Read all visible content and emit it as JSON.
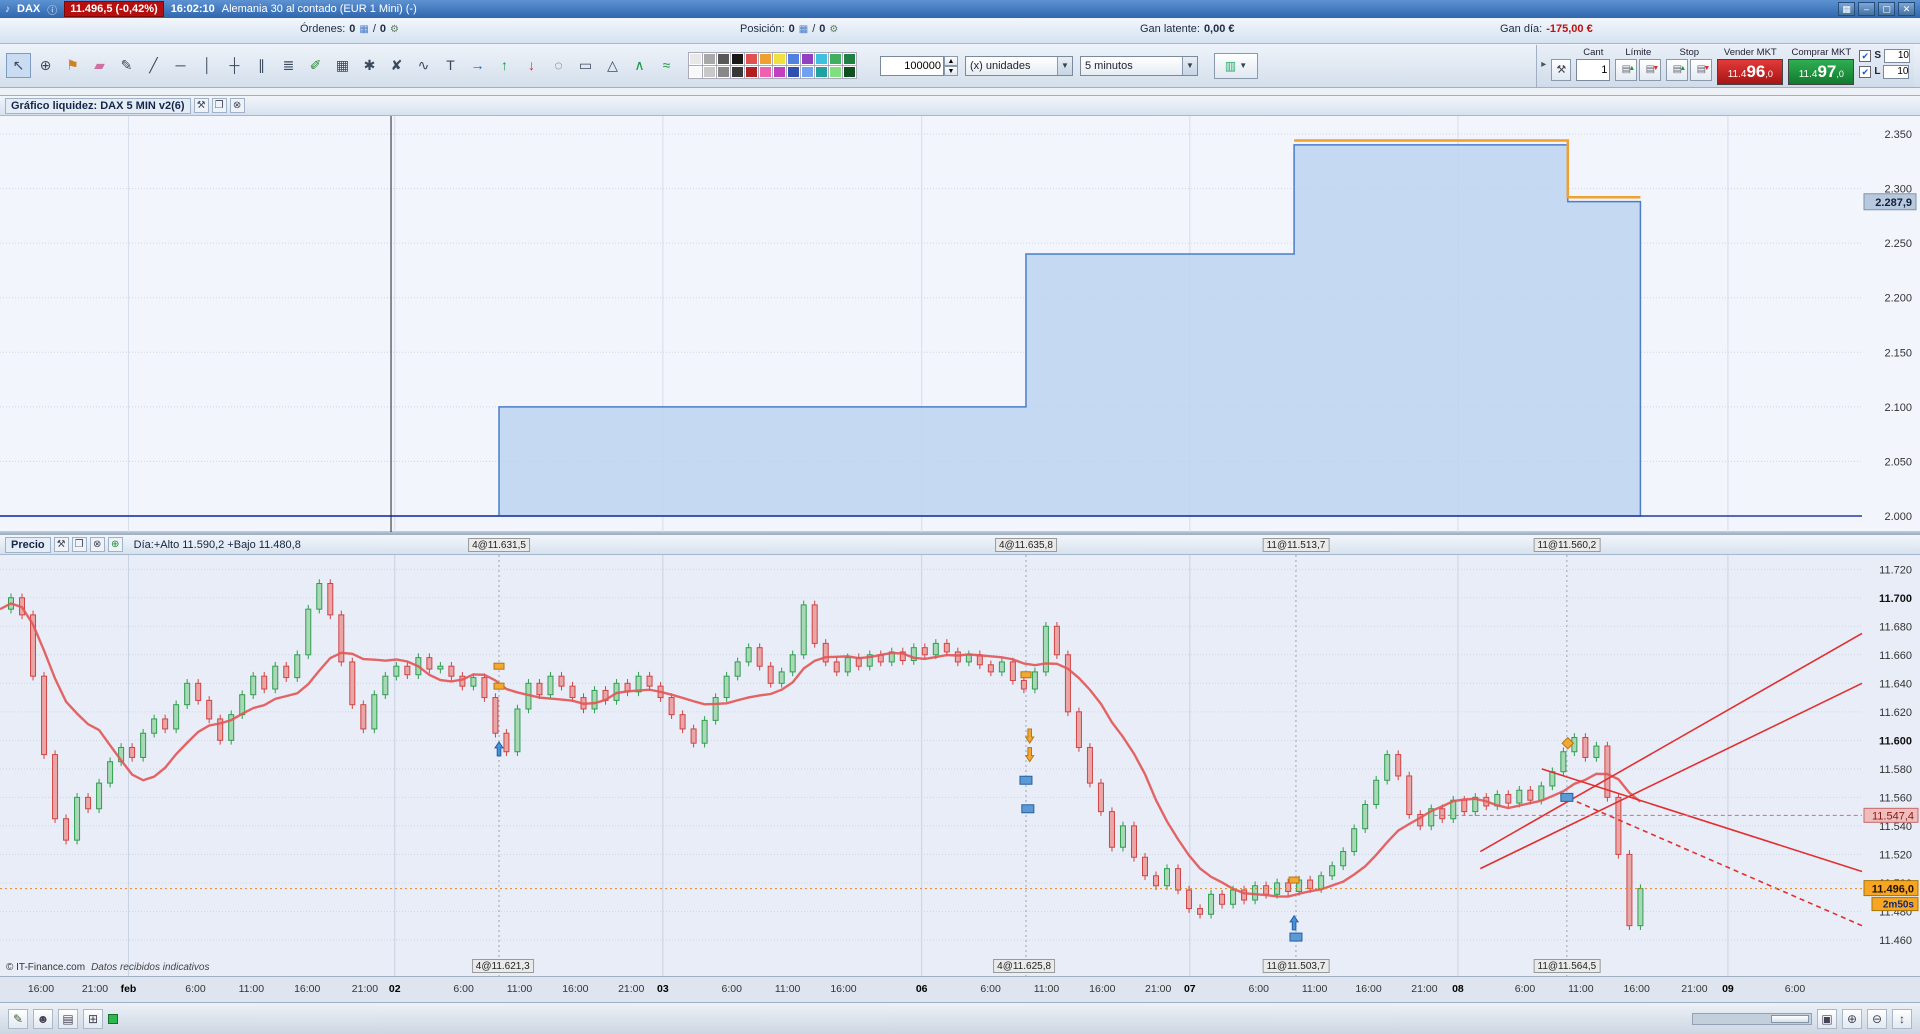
{
  "titlebar": {
    "instrument": "DAX",
    "price_badge": "11.496,5 (-0,42%)",
    "time": "16:02:10",
    "description": "Alemania 30 al contado (EUR 1 Mini) (-)",
    "window": {
      "minimize": "–",
      "maximize": "▢",
      "close": "✕"
    }
  },
  "infobar": {
    "ordenes_label": "Órdenes:",
    "ordenes_value": "0",
    "sep": "/",
    "ordenes_value2": "0",
    "posicion_label": "Posición:",
    "posicion_value": "0",
    "posicion_value2": "0",
    "gan_latente_label": "Gan latente:",
    "gan_latente_value": "0,00 €",
    "gan_dia_label": "Gan día:",
    "gan_dia_value": "-175,00 €"
  },
  "toolbar": {
    "tools": [
      {
        "name": "cursor-icon",
        "glyph": "↖",
        "active": true
      },
      {
        "name": "zoom-icon",
        "glyph": "⊕"
      },
      {
        "name": "alarm-icon",
        "glyph": "⚑",
        "color": "#d08020"
      },
      {
        "name": "eraser-icon",
        "glyph": "▰",
        "color": "#d070a0"
      },
      {
        "name": "pencil-icon",
        "glyph": "✎"
      },
      {
        "name": "trendline-icon",
        "glyph": "╱"
      },
      {
        "name": "horizontal-line-icon",
        "glyph": "─"
      },
      {
        "name": "vertical-line-icon",
        "glyph": "│"
      },
      {
        "name": "crosshair-icon",
        "glyph": "┼"
      },
      {
        "name": "parallel-lines-icon",
        "glyph": "∥"
      },
      {
        "name": "fibonacci-icon",
        "glyph": "≣"
      },
      {
        "name": "annotate-chart-icon",
        "glyph": "✐",
        "color": "#2a8a3a"
      },
      {
        "name": "trash-icon",
        "glyph": "▦"
      },
      {
        "name": "erase-drawings-icon",
        "glyph": "✱"
      },
      {
        "name": "delete-all-icon",
        "glyph": "✘"
      },
      {
        "name": "magnet-icon",
        "glyph": "∿"
      },
      {
        "name": "text-tool-icon",
        "glyph": "T"
      },
      {
        "name": "arrow-right-icon",
        "glyph": "→",
        "color": "#2a62c0"
      },
      {
        "name": "arrow-up-icon",
        "glyph": "↑",
        "color": "#1a9a40"
      },
      {
        "name": "arrow-down-icon",
        "glyph": "↓",
        "color": "#d03030"
      },
      {
        "name": "lasso-icon",
        "glyph": "◌"
      },
      {
        "name": "rectangle-icon",
        "glyph": "▭"
      },
      {
        "name": "triangle-icon",
        "glyph": "△"
      },
      {
        "name": "zigzag-icon",
        "glyph": "∧",
        "color": "#1a9a40"
      },
      {
        "name": "wave-icon",
        "glyph": "≈",
        "color": "#1a9a40"
      }
    ],
    "palette": [
      "#e8e8e8",
      "#f8f8f8",
      "#a8a8a8",
      "#c8c8c8",
      "#585858",
      "#888888",
      "#181818",
      "#383838",
      "#e05050",
      "#b02020",
      "#f0a030",
      "#f060b0",
      "#f0e040",
      "#c040c0",
      "#5080e0",
      "#3050b0",
      "#9040c0",
      "#70a0f0",
      "#40c0e0",
      "#20a0a0",
      "#40b060",
      "#80e080",
      "#208040",
      "#105020"
    ],
    "quantity_value": "100000",
    "units_select": "(x) unidades",
    "timeframe_select": "5 minutos",
    "trade": {
      "cant_label": "Cant",
      "cant_value": "1",
      "limite_label": "Límite",
      "stop_label": "Stop",
      "vender_label": "Vender MKT",
      "comprar_label": "Comprar MKT",
      "vender_price": {
        "pre": "11.4",
        "big": "96",
        "sup": ",0"
      },
      "comprar_price": {
        "pre": "11.4",
        "big": "97",
        "sup": ",0"
      },
      "s_label": "S",
      "s_value": "10",
      "l_label": "L",
      "l_value": "10",
      "check_glyph": "✔"
    }
  },
  "liquidity_panel": {
    "title": "Gráfico liquidez: DAX 5 MIN v2(6)",
    "badge": "2.287,9"
  },
  "price_panel": {
    "title": "Precio",
    "day_info": "Día:+Alto 11.590,2 +Bajo 11.480,8",
    "top_annotations": [
      {
        "x": 0.268,
        "text": "4@11.631,5"
      },
      {
        "x": 0.551,
        "text": "4@11.635,8"
      },
      {
        "x": 0.696,
        "text": "11@11.513,7"
      },
      {
        "x": 0.8415,
        "text": "11@11.560,2"
      }
    ],
    "bottom_annotations": [
      {
        "x": 0.27,
        "text": "4@11.621,3"
      },
      {
        "x": 0.55,
        "text": "4@11.625,8"
      },
      {
        "x": 0.696,
        "text": "11@11.503,7"
      },
      {
        "x": 0.8415,
        "text": "11@11.564,5"
      }
    ],
    "position_badge": "11.547,4",
    "last_price_badge": "11.496,0",
    "countdown_badge": "2m50s"
  },
  "timeline": {
    "labels": [
      {
        "x": 0.022,
        "text": "16:00",
        "bold": false
      },
      {
        "x": 0.051,
        "text": "21:00",
        "bold": false
      },
      {
        "x": 0.069,
        "text": "feb",
        "bold": true
      },
      {
        "x": 0.105,
        "text": "6:00",
        "bold": false
      },
      {
        "x": 0.135,
        "text": "11:00",
        "bold": false
      },
      {
        "x": 0.165,
        "text": "16:00",
        "bold": false
      },
      {
        "x": 0.196,
        "text": "21:00",
        "bold": false
      },
      {
        "x": 0.212,
        "text": "02",
        "bold": true
      },
      {
        "x": 0.249,
        "text": "6:00",
        "bold": false
      },
      {
        "x": 0.279,
        "text": "11:00",
        "bold": false
      },
      {
        "x": 0.309,
        "text": "16:00",
        "bold": false
      },
      {
        "x": 0.339,
        "text": "21:00",
        "bold": false
      },
      {
        "x": 0.356,
        "text": "03",
        "bold": true
      },
      {
        "x": 0.393,
        "text": "6:00",
        "bold": false
      },
      {
        "x": 0.423,
        "text": "11:00",
        "bold": false
      },
      {
        "x": 0.453,
        "text": "16:00",
        "bold": false
      },
      {
        "x": 0.495,
        "text": "06",
        "bold": true
      },
      {
        "x": 0.532,
        "text": "6:00",
        "bold": false
      },
      {
        "x": 0.562,
        "text": "11:00",
        "bold": false
      },
      {
        "x": 0.592,
        "text": "16:00",
        "bold": false
      },
      {
        "x": 0.622,
        "text": "21:00",
        "bold": false
      },
      {
        "x": 0.639,
        "text": "07",
        "bold": true
      },
      {
        "x": 0.676,
        "text": "6:00",
        "bold": false
      },
      {
        "x": 0.706,
        "text": "11:00",
        "bold": false
      },
      {
        "x": 0.735,
        "text": "16:00",
        "bold": false
      },
      {
        "x": 0.765,
        "text": "21:00",
        "bold": false
      },
      {
        "x": 0.783,
        "text": "08",
        "bold": true
      },
      {
        "x": 0.819,
        "text": "6:00",
        "bold": false
      },
      {
        "x": 0.849,
        "text": "11:00",
        "bold": false
      },
      {
        "x": 0.879,
        "text": "16:00",
        "bold": false
      },
      {
        "x": 0.91,
        "text": "21:00",
        "bold": false
      },
      {
        "x": 0.928,
        "text": "09",
        "bold": true
      },
      {
        "x": 0.964,
        "text": "6:00",
        "bold": false
      }
    ]
  },
  "statusbar": {
    "copyright": "© IT-Finance.com",
    "note": "Datos recibidos indicativos"
  },
  "chart_data": [
    {
      "type": "area",
      "title": "Gráfico liquidez: DAX 5 MIN v2(6)",
      "ylim": [
        2000,
        2350
      ],
      "y_ticks": [
        {
          "v": 2350,
          "label": "2.350"
        },
        {
          "v": 2300,
          "label": "2.300"
        },
        {
          "v": 2250,
          "label": "2.250"
        },
        {
          "v": 2200,
          "label": "2.200"
        },
        {
          "v": 2150,
          "label": "2.150"
        },
        {
          "v": 2100,
          "label": "2.100"
        },
        {
          "v": 2050,
          "label": "2.050"
        },
        {
          "v": 2000,
          "label": "2.000"
        }
      ],
      "current_value": 2287.9,
      "baseline": 2000,
      "day_marker_x": 0.21,
      "steps": [
        {
          "x0": 0.0,
          "x1": 0.268,
          "v": 2000
        },
        {
          "x0": 0.268,
          "x1": 0.551,
          "v": 2100
        },
        {
          "x0": 0.551,
          "x1": 0.695,
          "v": 2240
        },
        {
          "x0": 0.695,
          "x1": 0.842,
          "v": 2340
        },
        {
          "x0": 0.842,
          "x1": 0.881,
          "v": 2288
        }
      ],
      "overlay_line": {
        "color": "#f0a030",
        "segments": [
          {
            "x0": 0.695,
            "x1": 0.842,
            "v": 2344
          },
          {
            "x0": 0.842,
            "x1": 0.881,
            "v": 2292
          }
        ]
      }
    },
    {
      "type": "candlestick",
      "title": "Precio",
      "timeframe": "5 minutos",
      "ylim": [
        11434,
        11730
      ],
      "y_ticks": [
        {
          "v": 11720,
          "label": "11.720",
          "bold": false
        },
        {
          "v": 11700,
          "label": "11.700",
          "bold": true
        },
        {
          "v": 11680,
          "label": "11.680",
          "bold": false
        },
        {
          "v": 11660,
          "label": "11.660",
          "bold": false
        },
        {
          "v": 11640,
          "label": "11.640",
          "bold": false
        },
        {
          "v": 11620,
          "label": "11.620",
          "bold": false
        },
        {
          "v": 11600,
          "label": "11.600",
          "bold": true
        },
        {
          "v": 11580,
          "label": "11.580",
          "bold": false
        },
        {
          "v": 11560,
          "label": "11.560",
          "bold": false
        },
        {
          "v": 11540,
          "label": "11.540",
          "bold": false
        },
        {
          "v": 11520,
          "label": "11.520",
          "bold": false
        },
        {
          "v": 11500,
          "label": "11.500",
          "bold": true
        },
        {
          "v": 11480,
          "label": "11.480",
          "bold": false
        },
        {
          "v": 11460,
          "label": "11.460",
          "bold": false
        }
      ],
      "x_end_frac": 0.881,
      "ma_window": 10,
      "last_price": 11496.0,
      "position_price": 11547.4,
      "day_high": 11590.2,
      "day_low": 11480.8,
      "day_gridlines": [
        0.069,
        0.212,
        0.356,
        0.495,
        0.639,
        0.783,
        0.928
      ],
      "closes": [
        11692,
        11700,
        11688,
        11645,
        11590,
        11545,
        11530,
        11560,
        11552,
        11570,
        11585,
        11595,
        11588,
        11605,
        11615,
        11608,
        11625,
        11640,
        11628,
        11615,
        11600,
        11618,
        11632,
        11645,
        11636,
        11652,
        11644,
        11660,
        11692,
        11710,
        11688,
        11655,
        11625,
        11608,
        11632,
        11645,
        11652,
        11646,
        11658,
        11650,
        11652,
        11645,
        11638,
        11644,
        11630,
        11605,
        11592,
        11622,
        11640,
        11632,
        11645,
        11638,
        11630,
        11622,
        11635,
        11628,
        11640,
        11634,
        11645,
        11638,
        11630,
        11618,
        11608,
        11598,
        11614,
        11630,
        11645,
        11655,
        11665,
        11652,
        11640,
        11648,
        11660,
        11695,
        11668,
        11655,
        11648,
        11658,
        11652,
        11660,
        11655,
        11662,
        11656,
        11665,
        11660,
        11668,
        11662,
        11655,
        11660,
        11653,
        11648,
        11655,
        11642,
        11636,
        11648,
        11680,
        11660,
        11620,
        11595,
        11570,
        11550,
        11525,
        11540,
        11518,
        11505,
        11498,
        11510,
        11495,
        11482,
        11478,
        11492,
        11485,
        11495,
        11488,
        11498,
        11492,
        11500,
        11494,
        11502,
        11496,
        11505,
        11512,
        11522,
        11538,
        11555,
        11572,
        11590,
        11575,
        11548,
        11540,
        11552,
        11545,
        11558,
        11550,
        11560,
        11554,
        11562,
        11556,
        11565,
        11558,
        11568,
        11578,
        11592,
        11602,
        11588,
        11596,
        11560,
        11520,
        11470,
        11496
      ],
      "trend_lines": [
        {
          "x0": 0.795,
          "y0": 11522,
          "x1": 1.0,
          "y1": 11675,
          "dash": false
        },
        {
          "x0": 0.795,
          "y0": 11510,
          "x1": 1.0,
          "y1": 11640,
          "dash": false
        },
        {
          "x0": 0.828,
          "y0": 11580,
          "x1": 1.0,
          "y1": 11508,
          "dash": false
        },
        {
          "x0": 0.838,
          "y0": 11562,
          "x1": 1.0,
          "y1": 11470,
          "dash": true
        }
      ],
      "markers": [
        {
          "x": 0.268,
          "p": 11652,
          "kind": "orange-rect"
        },
        {
          "x": 0.268,
          "p": 11638,
          "kind": "orange-rect"
        },
        {
          "x": 0.268,
          "p": 11594,
          "kind": "blue-arrow-up"
        },
        {
          "x": 0.551,
          "p": 11646,
          "kind": "orange-rect"
        },
        {
          "x": 0.553,
          "p": 11603,
          "kind": "orange-arrow-down"
        },
        {
          "x": 0.553,
          "p": 11590,
          "kind": "orange-arrow-down"
        },
        {
          "x": 0.551,
          "p": 11572,
          "kind": "blue-rect"
        },
        {
          "x": 0.552,
          "p": 11552,
          "kind": "blue-rect"
        },
        {
          "x": 0.695,
          "p": 11502,
          "kind": "orange-rect"
        },
        {
          "x": 0.695,
          "p": 11472,
          "kind": "blue-arrow-up"
        },
        {
          "x": 0.696,
          "p": 11462,
          "kind": "blue-rect"
        },
        {
          "x": 0.842,
          "p": 11598,
          "kind": "orange-diamond"
        },
        {
          "x": 0.8415,
          "p": 11560,
          "kind": "blue-rect"
        }
      ]
    }
  ]
}
